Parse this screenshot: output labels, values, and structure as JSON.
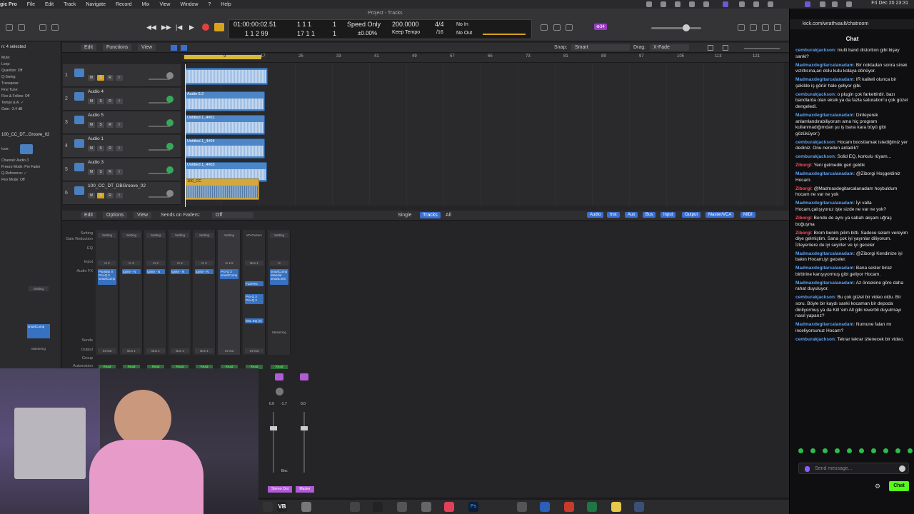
{
  "menubar": {
    "items": [
      "gic Pro",
      "File",
      "Edit",
      "Track",
      "Navigate",
      "Record",
      "Mix",
      "View",
      "Window",
      "?",
      "Help"
    ],
    "clock": "Fri Dec 20  23:31"
  },
  "logic": {
    "window_title": "Project - Tracks",
    "lcd": {
      "time": "01:00:00:02.51",
      "bars": "1  1  2   99",
      "pos_a": "1  1  1",
      "pos_b": "17  1  1",
      "pos_c": "1",
      "pos_d": "1",
      "mode": "Speed Only",
      "percent": "±0.00%",
      "tempo": "200.0000",
      "keep_tempo": "Keep Tempo",
      "sig": "4/4",
      "div": "/16",
      "in": "No In",
      "out": "No Out"
    },
    "badge": "⊕34",
    "arrange_menus": [
      "Edit",
      "Functions",
      "View"
    ],
    "snap_label": "Snap:",
    "snap_value": "Smart",
    "drag_label": "Drag:",
    "drag_value": "X-Fade",
    "ruler": [
      "9",
      "17",
      "25",
      "33",
      "41",
      "49",
      "57",
      "65",
      "73",
      "81",
      "89",
      "97",
      "105",
      "113",
      "121"
    ],
    "tracks": [
      {
        "num": "1",
        "name": ""
      },
      {
        "num": "2",
        "name": "Audio 4"
      },
      {
        "num": "3",
        "name": "Audio 5"
      },
      {
        "num": "4",
        "name": "Audio 1"
      },
      {
        "num": "5",
        "name": "Audio 3"
      },
      {
        "num": "6",
        "name": "100_CC_DT_DBGroove_02"
      }
    ],
    "regions": [
      "",
      "Audio 6.2",
      "Untitled 1_4#01",
      "Untitled 1_4#04",
      "Untitled 1_4#03",
      "100_CC"
    ],
    "inspector": {
      "selected": "n: 4 selected",
      "rows": [
        "Mute:",
        "Loop:",
        "Quantize: Off",
        "Q-Swing:",
        "Transpose:",
        "Fine Tune:",
        "Flex & Follow: Off",
        "Tempo & A. ✓",
        "Gain: -2.4 dB"
      ],
      "region_name": "100_CC_DT...Groove_02",
      "rows2": [
        "Icon:",
        "Channel: Audio 3",
        "Freeze Mode: Pre Fader",
        "Q-Reference: ✓",
        "Flex Mode: Off"
      ]
    },
    "mixer": {
      "menus": [
        "Edit",
        "Options",
        "View"
      ],
      "sends_label": "Sends on Faders:",
      "sends_value": "Off",
      "views": [
        "Single",
        "Tracks",
        "All"
      ],
      "filters": [
        "Audio",
        "Inst",
        "Aux",
        "Bus",
        "Input",
        "Output",
        "Master/VCA",
        "MIDI"
      ],
      "row_labels": [
        "Setting",
        "Gain Reduction",
        "EQ",
        "Input",
        "Audio FX",
        "Sends",
        "Output",
        "Group",
        "Automation"
      ],
      "strips": [
        {
          "setting": "Setting",
          "input": "In 2",
          "fx": [
            "Parallax X",
            "Pro-Q 3",
            "smartComp"
          ],
          "output": "St Out",
          "auto": "Read"
        },
        {
          "setting": "Setting",
          "input": "In 2",
          "fx": [
            "Ignite - N"
          ],
          "output": "Bus 1",
          "auto": "Read"
        },
        {
          "setting": "Setting",
          "input": "In 2",
          "fx": [
            "Ignite - N"
          ],
          "output": "Bus 1",
          "auto": "Read"
        },
        {
          "setting": "Setting",
          "input": "In 2",
          "fx": [
            "Ignite - N"
          ],
          "output": "Bus 1",
          "auto": "Read"
        },
        {
          "setting": "Setting",
          "input": "In 2",
          "fx": [
            "Ignite - N"
          ],
          "output": "Bus 1",
          "auto": "Read"
        },
        {
          "setting": "Setting",
          "input": "In 1/2",
          "fx": [
            "Pro-Q 3",
            "smartComp"
          ],
          "output": "St Out",
          "auto": "Read"
        },
        {
          "setting": "WVGuitars",
          "input": "Bus 1",
          "fx": [
            "FuzeTec",
            "Pro-Q 3",
            "Pro-Q 3",
            "SSL EQ (s)"
          ],
          "output": "St Out",
          "auto": "Read"
        },
        {
          "setting": "Setting",
          "input": "",
          "fx": [
            "smartComp",
            "Standar",
            "smartLimit"
          ],
          "output": "",
          "auto": "Read",
          "extra": "Mastering"
        }
      ],
      "meters": {
        "a": "0.0",
        "b": "-1.7",
        "c": "0.0"
      },
      "bottom": {
        "bnc": "Bnc",
        "stereo_out": "Stereo Out",
        "master": "Master"
      }
    }
  },
  "browser": {
    "url": "kick.com/wrathvault/chatroom",
    "chat_title": "Chat",
    "colors": {
      "blue_user": "#5ea0f0",
      "red_user": "#ff4f5a",
      "green": "#53fc18"
    },
    "messages": [
      {
        "user": "cemburakjackson",
        "color": "#5ea0f0",
        "text": "multi band distortion gibi bişey sanki?"
      },
      {
        "user": "Madmaxdegitarcalanadam",
        "color": "#5ea0f0",
        "text": "Bir noktadan sonra sinek vızıltısına,arı dolu kutu kolaya dönüyor."
      },
      {
        "user": "Madmaxdegitarcalanadam",
        "color": "#5ea0f0",
        "text": "IR kaliteli olunca bir şekilde iş görür hale geliyor gibi."
      },
      {
        "user": "cemburakjackson",
        "color": "#5ea0f0",
        "text": "o plugin çok farkettirdir. bazı bandlarda olan eksik ya da fazla saturation'u çok güzel dengeledi."
      },
      {
        "user": "Madmaxdegitarcalanadam",
        "color": "#5ea0f0",
        "text": "Dinleyerek anlamlandırabiliyorum ama hiç program kullanmadığımdan şu iş bana kara büyü gibi gözüküyor:)"
      },
      {
        "user": "cemburakjackson",
        "color": "#5ea0f0",
        "text": "Hocam boostlamak istediğimiz yer dediniz. Onu nereden anladık?"
      },
      {
        "user": "cemburakjackson",
        "color": "#5ea0f0",
        "text": "Solid EQ, korkulu rüyam..."
      },
      {
        "user": "Ziborgi",
        "color": "#ff4f5a",
        "text": "Yeni gelmedik geri geldik"
      },
      {
        "user": "Madmaxdegitarcalanadam",
        "color": "#5ea0f0",
        "text": "@Ziborgi Hoşgeldiniz Hocam."
      },
      {
        "user": "Ziborgi",
        "color": "#ff4f5a",
        "text": "@Madmaxdegitarcalanadam hoşbuldum hocam ne var ne yok"
      },
      {
        "user": "Madmaxdegitarcalanadam",
        "color": "#5ea0f0",
        "text": "İyi valla Hocam,çalışıyoruz işte sizde ne var ne yok?"
      },
      {
        "user": "Ziborgi",
        "color": "#ff4f5a",
        "text": "Bende de aynı ya sabah akşam uğraş boğuşma"
      },
      {
        "user": "Ziborgi",
        "color": "#ff4f5a",
        "text": "Brom benim pilim bitti. Sadece selam vereyim diye gelmiştim. Sana çok iyi yayınlar diliyorum. İzleyenlere de iyi seyirler ve iyi geceler"
      },
      {
        "user": "Madmaxdegitarcalanadam",
        "color": "#5ea0f0",
        "text": "@Ziborgi Kendinize iyi bakın Hocam,iyi geceler."
      },
      {
        "user": "Madmaxdegitarcalanadam",
        "color": "#5ea0f0",
        "text": "Bana sesler biraz birbirine karışıyormuş gibi geliyor Hocam."
      },
      {
        "user": "Madmaxdegitarcalanadam",
        "color": "#5ea0f0",
        "text": "Az öncekine göre daha rahat duyuluyor."
      },
      {
        "user": "cemburakjackson",
        "color": "#5ea0f0",
        "text": "Bu çok güzel bir video oldu. Bir soru. Böyle bir kaydı sanki kocaman bir depoda dinliyormuş ya da Kill 'em All gibi reverbli duyulmayı nasıl yaparız?"
      },
      {
        "user": "Madmaxdegitarcalanadam",
        "color": "#5ea0f0",
        "text": "Numune falan mı inceliyorsunuz Hocam?"
      },
      {
        "user": "cemburakjackson",
        "color": "#5ea0f0",
        "text": "Tekrar tekrar izlenecek bir video."
      }
    ],
    "send_placeholder": "Send message...",
    "chat_button": "Chat"
  }
}
